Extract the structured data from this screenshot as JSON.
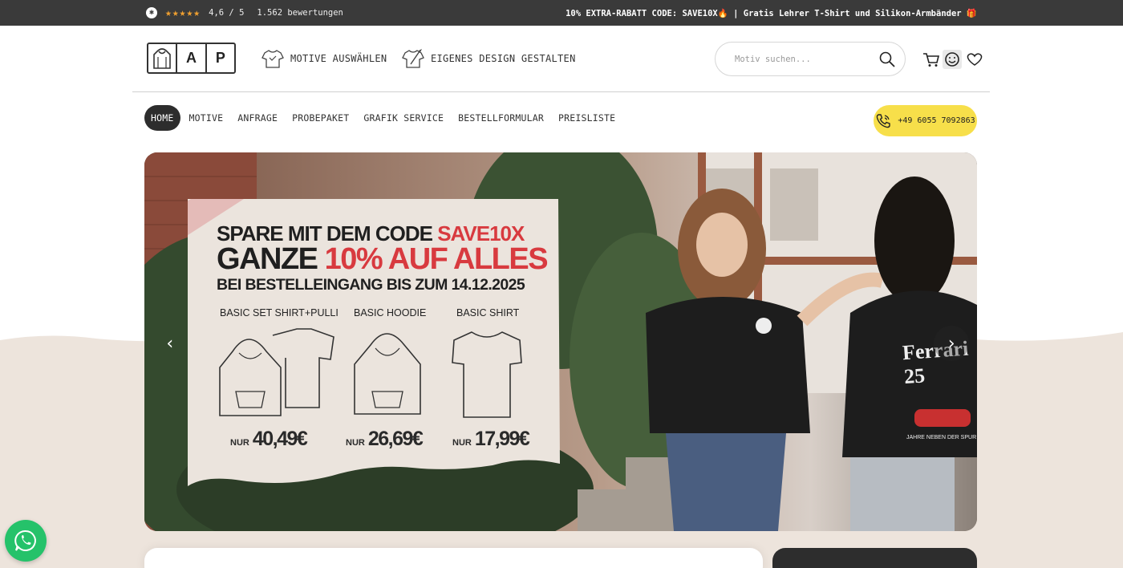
{
  "topbar": {
    "stars": "★★★★★",
    "rating": "4,6 / 5",
    "reviews": "1.562 bewertungen",
    "promo": "10% EXTRA-RABATT CODE: SAVE10X🔥 | Gratis Lehrer T-Shirt und Silikon-Armbänder 🎁",
    "star_color": "#f0a030"
  },
  "header": {
    "logo": [
      "",
      "A",
      "P"
    ],
    "links": [
      {
        "label": "MOTIVE AUSWÄHLEN",
        "icon": "shirt-icon"
      },
      {
        "label": "EIGENES DESIGN GESTALTEN",
        "icon": "design-shirt-icon"
      }
    ],
    "search_placeholder": "Motiv suchen...",
    "icons": [
      "cart-icon",
      "account-icon",
      "wishlist-icon"
    ]
  },
  "nav": {
    "items": [
      "HOME",
      "MOTIVE",
      "ANFRAGE",
      "PROBEPAKET",
      "GRAFIK SERVICE",
      "BESTELLFORMULAR",
      "PREISLISTE"
    ],
    "phone": "+49 6055 7092863",
    "phone_color": "#f7df4a"
  },
  "hero": {
    "line1_a": "SPARE MIT DEM CODE ",
    "line1_b": "SAVE10X",
    "line2_a": "GANZE ",
    "line2_b": "10% AUF ALLES",
    "line3": "BEI BESTELLEINGANG BIS ZUM 14.12.2025",
    "products": [
      {
        "label": "BASIC SET SHIRT+PULLI",
        "nur": "NUR",
        "price": "40,49€"
      },
      {
        "label": "BASIC HOODIE",
        "nur": "NUR",
        "price": "26,69€"
      },
      {
        "label": "BASIC SHIRT",
        "nur": "NUR",
        "price": "17,99€"
      }
    ],
    "back_print_text": "Ferrari 25",
    "back_print_caption": "JAHRE NEBEN DER SPUR",
    "accent_color": "#d83a3f"
  }
}
